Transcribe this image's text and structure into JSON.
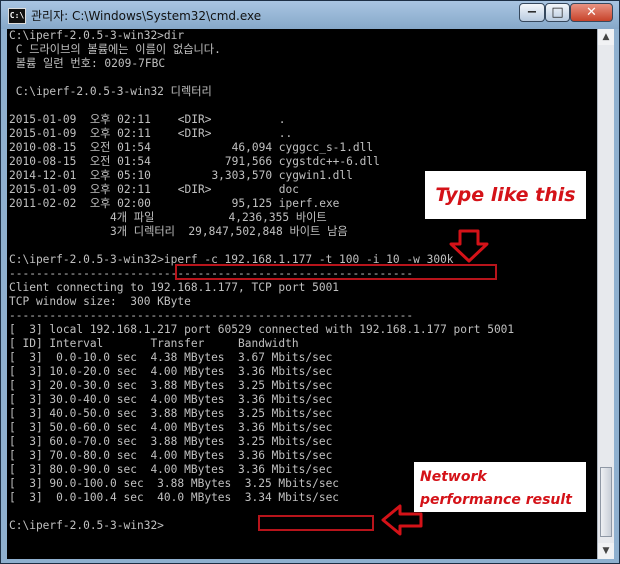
{
  "window": {
    "title": "관리자: C:\\Windows\\System32\\cmd.exe",
    "app_icon_text": "C:\\",
    "buttons": {
      "minimize": "−",
      "maximize": "□",
      "close": "✕"
    }
  },
  "console": {
    "lines": [
      "C:\\iperf-2.0.5-3-win32>dir",
      " C 드라이브의 볼륨에는 이름이 없습니다.",
      " 볼륨 일련 번호: 0209-7FBC",
      "",
      " C:\\iperf-2.0.5-3-win32 디렉터리",
      "",
      "2015-01-09  오후 02:11    <DIR>          .",
      "2015-01-09  오후 02:11    <DIR>          ..",
      "2010-08-15  오전 01:54            46,094 cyggcc_s-1.dll",
      "2010-08-15  오전 01:54           791,566 cygstdc++-6.dll",
      "2014-12-01  오후 05:10         3,303,570 cygwin1.dll",
      "2015-01-09  오후 02:11    <DIR>          doc",
      "2011-02-02  오후 02:00            95,125 iperf.exe",
      "               4개 파일           4,236,355 바이트",
      "               3개 디렉터리  29,847,502,848 바이트 남음",
      "",
      "C:\\iperf-2.0.5-3-win32>iperf -c 192.168.1.177 -t 100 -i 10 -w 300k",
      "------------------------------------------------------------",
      "Client connecting to 192.168.1.177, TCP port 5001",
      "TCP window size:  300 KByte",
      "------------------------------------------------------------",
      "[  3] local 192.168.1.217 port 60529 connected with 192.168.1.177 port 5001",
      "[ ID] Interval       Transfer     Bandwidth",
      "[  3]  0.0-10.0 sec  4.38 MBytes  3.67 Mbits/sec",
      "[  3] 10.0-20.0 sec  4.00 MBytes  3.36 Mbits/sec",
      "[  3] 20.0-30.0 sec  3.88 MBytes  3.25 Mbits/sec",
      "[  3] 30.0-40.0 sec  4.00 MBytes  3.36 Mbits/sec",
      "[  3] 40.0-50.0 sec  3.88 MBytes  3.25 Mbits/sec",
      "[  3] 50.0-60.0 sec  4.00 MBytes  3.36 Mbits/sec",
      "[  3] 60.0-70.0 sec  3.88 MBytes  3.25 Mbits/sec",
      "[  3] 70.0-80.0 sec  4.00 MBytes  3.36 Mbits/sec",
      "[  3] 80.0-90.0 sec  4.00 MBytes  3.36 Mbits/sec",
      "[  3] 90.0-100.0 sec  3.88 MBytes  3.25 Mbits/sec",
      "[  3]  0.0-100.4 sec  40.0 MBytes  3.34 Mbits/sec",
      "",
      "C:\\iperf-2.0.5-3-win32>"
    ]
  },
  "annotations": {
    "type_hint": "Type like this",
    "result_hint": "Network performance result",
    "accent_color": "#d41218"
  },
  "scrollbar": {
    "up": "▲",
    "down": "▼"
  }
}
